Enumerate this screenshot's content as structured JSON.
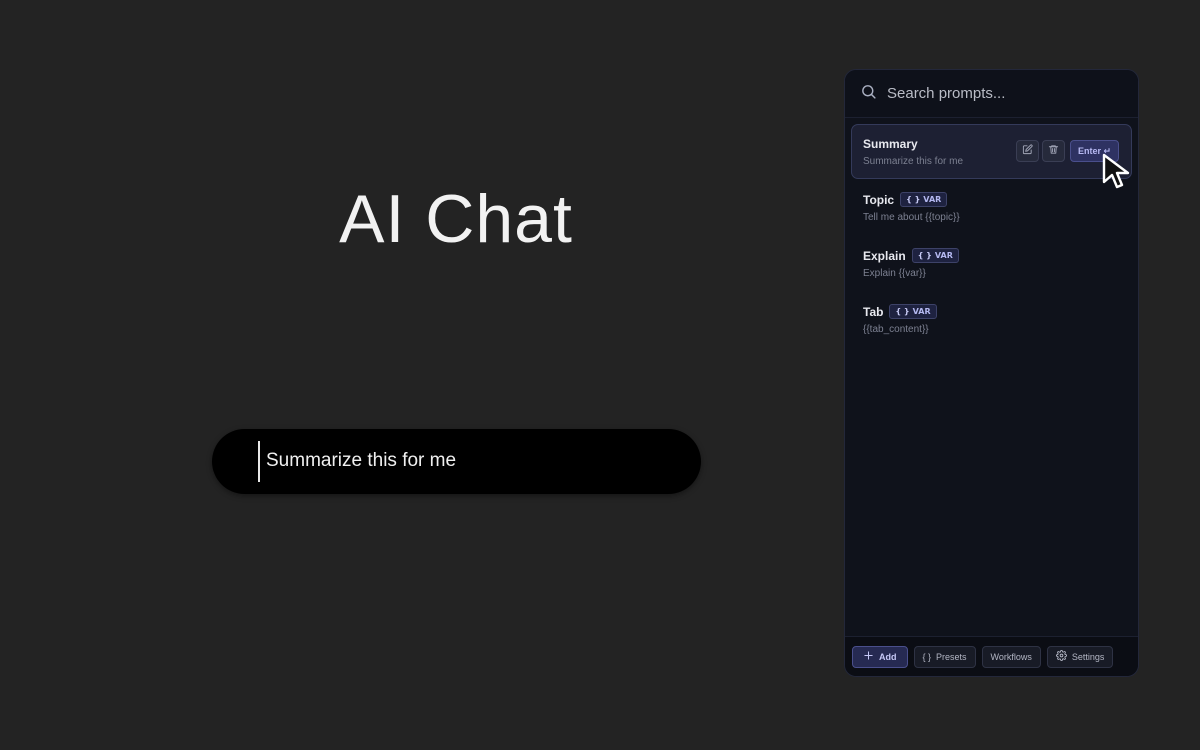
{
  "app": {
    "title": "AI Chat"
  },
  "chat": {
    "input_value": "Summarize this for me"
  },
  "panel": {
    "search": {
      "placeholder": "Search prompts..."
    },
    "badge_label": "VAR",
    "badge_braces": "{ }",
    "items": [
      {
        "title": "Summary",
        "subtitle": "Summarize this for me",
        "has_var": false,
        "active": true
      },
      {
        "title": "Topic",
        "subtitle": "Tell me about {{topic}}",
        "has_var": true,
        "active": false
      },
      {
        "title": "Explain",
        "subtitle": "Explain {{var}}",
        "has_var": true,
        "active": false
      },
      {
        "title": "Tab",
        "subtitle": "{{tab_content}}",
        "has_var": true,
        "active": false
      }
    ],
    "active_actions": {
      "enter_label": "Enter ↵",
      "edit_icon": "edit-icon",
      "delete_icon": "trash-icon"
    },
    "footer": {
      "add_label": "Add",
      "presets_label": "Presets",
      "presets_braces": "{ }",
      "workflows_label": "Workflows",
      "settings_label": "Settings"
    }
  },
  "colors": {
    "background": "#232323",
    "panel": "#0f121b",
    "accent": "#b7b9f3",
    "input_bg": "#000000"
  }
}
